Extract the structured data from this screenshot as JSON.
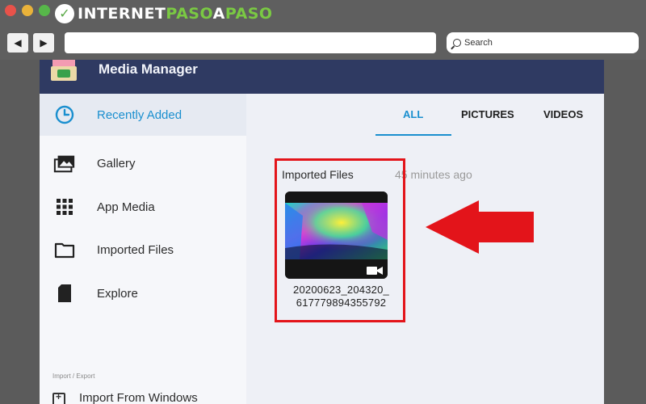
{
  "browser": {
    "logo_part1": "INTERNET",
    "logo_part2": "PASO",
    "logo_part3": "A",
    "logo_part4": "PASO",
    "logo_badge": "✓",
    "back_label": "◀",
    "forward_label": "▶",
    "search_placeholder": "Search"
  },
  "app": {
    "title": "Media Manager"
  },
  "sidebar": {
    "items": [
      {
        "label": "Recently Added",
        "icon": "clock-icon",
        "active": true
      },
      {
        "label": "Gallery",
        "icon": "gallery-icon"
      },
      {
        "label": "App Media",
        "icon": "grid-icon"
      },
      {
        "label": "Imported Files",
        "icon": "folder-icon"
      },
      {
        "label": "Explore",
        "icon": "sd-card-icon"
      }
    ],
    "section_label": "Import / Export",
    "import_label": "Import From Windows"
  },
  "tabs": [
    {
      "label": "ALL",
      "active": true
    },
    {
      "label": "PICTURES"
    },
    {
      "label": "VIDEOS"
    }
  ],
  "content": {
    "group_title": "Imported Files",
    "group_time": "45 minutes ago",
    "file_name_line1": "20200623_204320_",
    "file_name_line2": "617779894355792"
  },
  "colors": {
    "header": "#2f3a62",
    "accent": "#1a8fcf",
    "annotation": "#e3141a"
  }
}
